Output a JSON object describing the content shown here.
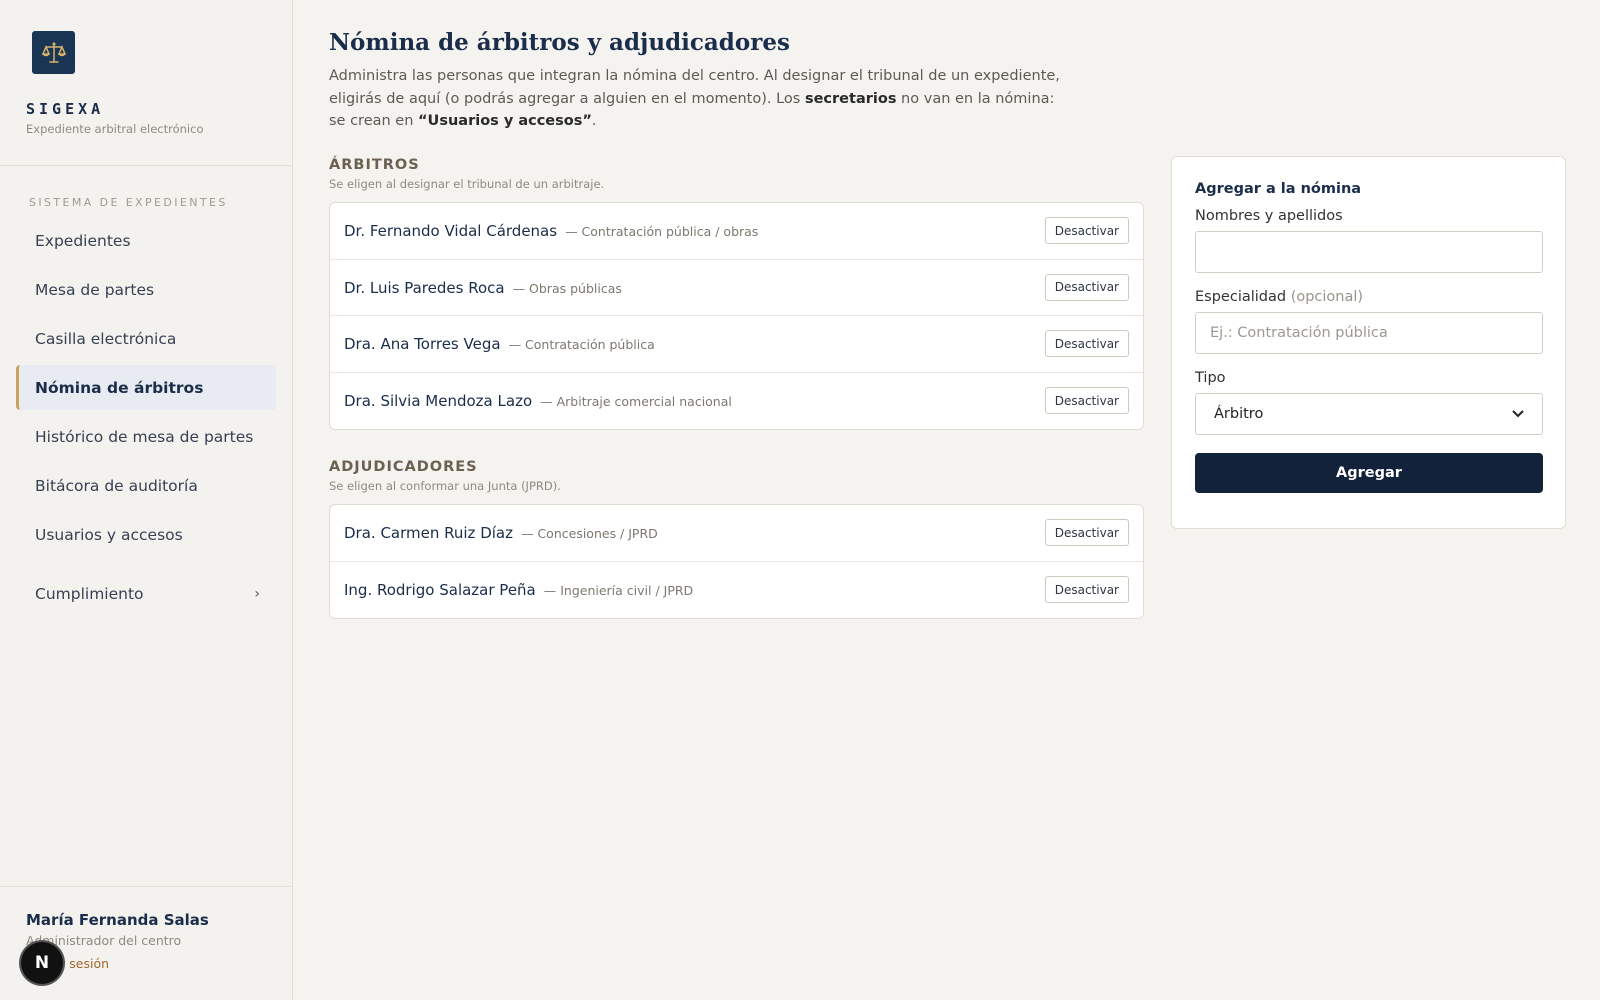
{
  "brand": {
    "name": "SIGEXA",
    "tagline": "Expediente arbitral electrónico",
    "logo_icon": "scales-icon"
  },
  "sidebar": {
    "section_label": "SISTEMA DE EXPEDIENTES",
    "items": [
      {
        "label": "Expedientes",
        "active": false
      },
      {
        "label": "Mesa de partes",
        "active": false
      },
      {
        "label": "Casilla electrónica",
        "active": false
      },
      {
        "label": "Nómina de árbitros",
        "active": true
      },
      {
        "label": "Histórico de mesa de partes",
        "active": false
      },
      {
        "label": "Bitácora de auditoría",
        "active": false
      },
      {
        "label": "Usuarios y accesos",
        "active": false
      }
    ],
    "group": {
      "label": "Cumplimiento",
      "chevron": "›"
    }
  },
  "user": {
    "name": "María Fernanda Salas",
    "role": "Administrador del centro",
    "logout": "Cerrar sesión",
    "avatar_letter": "N"
  },
  "page": {
    "title": "Nómina de árbitros y adjudicadores",
    "desc_1": "Administra las personas que integran la nómina del centro. Al designar el tribunal de un expediente, eligirás de aquí (o podrás agregar a alguien en el momento). Los ",
    "desc_bold_1": "secretarios",
    "desc_2": " no van en la nómina: se crean en ",
    "desc_bold_2": "“Usuarios y accesos”",
    "desc_3": "."
  },
  "arbitros": {
    "heading": "ÁRBITROS",
    "subheading": "Se eligen al designar el tribunal de un arbitraje.",
    "rows": [
      {
        "name": "Dr. Fernando Vidal Cárdenas",
        "spec": "— Contratación pública / obras",
        "action": "Desactivar"
      },
      {
        "name": "Dr. Luis Paredes Roca",
        "spec": "— Obras públicas",
        "action": "Desactivar"
      },
      {
        "name": "Dra. Ana Torres Vega",
        "spec": "— Contratación pública",
        "action": "Desactivar"
      },
      {
        "name": "Dra. Silvia Mendoza Lazo",
        "spec": "— Arbitraje comercial nacional",
        "action": "Desactivar"
      }
    ]
  },
  "adjudicadores": {
    "heading": "ADJUDICADORES",
    "subheading": "Se eligen al conformar una Junta (JPRD).",
    "rows": [
      {
        "name": "Dra. Carmen Ruiz Díaz",
        "spec": "— Concesiones / JPRD",
        "action": "Desactivar"
      },
      {
        "name": "Ing. Rodrigo Salazar Peña",
        "spec": "— Ingeniería civil / JPRD",
        "action": "Desactivar"
      }
    ]
  },
  "form": {
    "title": "Agregar a la nómina",
    "name_label": "Nombres y apellidos",
    "name_value": "",
    "spec_label": "Especialidad",
    "spec_optional": "(opcional)",
    "spec_placeholder": "Ej.: Contratación pública",
    "type_label": "Tipo",
    "type_value": "Árbitro",
    "submit": "Agregar"
  },
  "colors": {
    "accent": "#c9a35e",
    "primary": "#13223b",
    "logo_bg": "#1a3553"
  }
}
